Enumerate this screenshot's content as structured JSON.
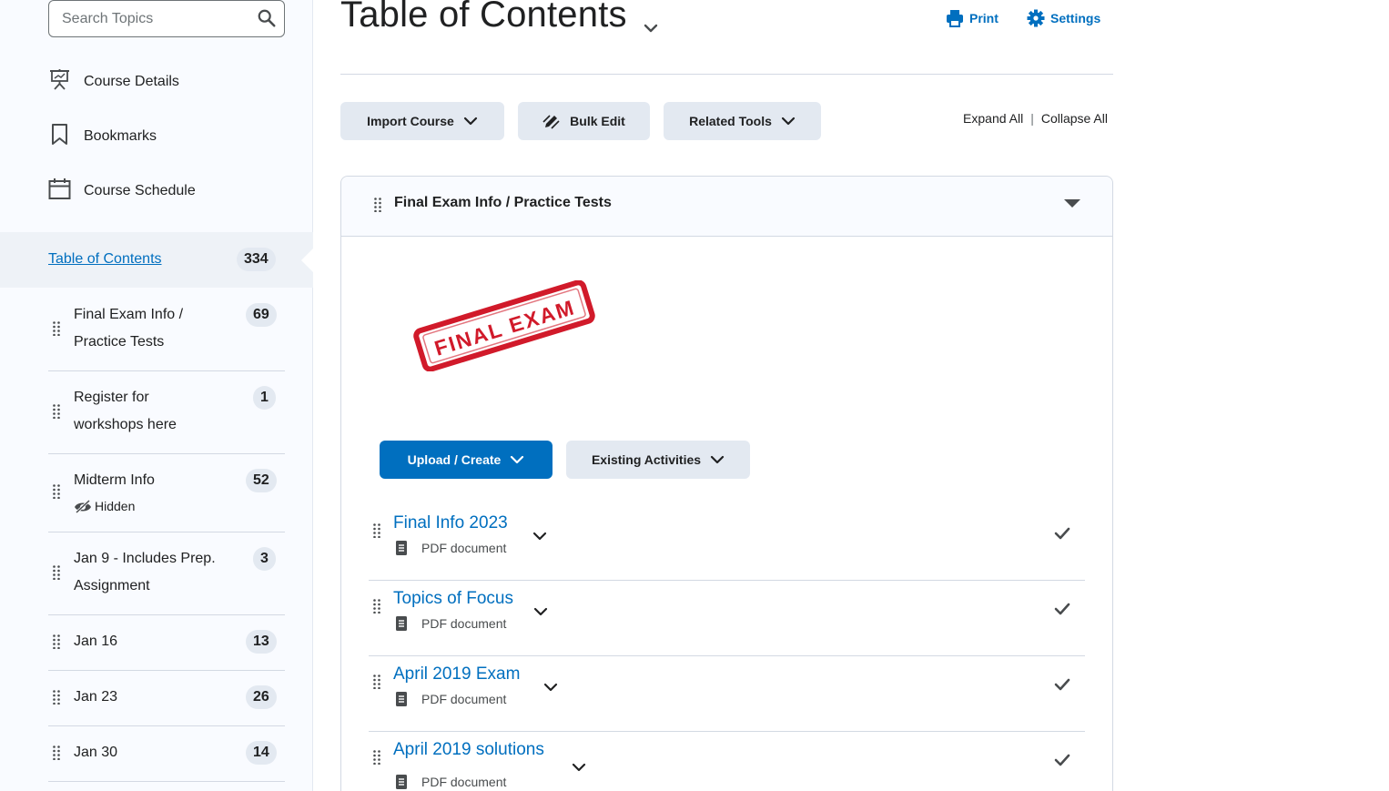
{
  "sidebar": {
    "search_placeholder": "Search Topics",
    "links": [
      {
        "label": "Course Details",
        "icon": "presentation-icon"
      },
      {
        "label": "Bookmarks",
        "icon": "bookmark-icon"
      },
      {
        "label": "Course Schedule",
        "icon": "calendar-icon"
      }
    ],
    "toc": {
      "label": "Table of Contents",
      "count": "334"
    },
    "modules": [
      {
        "title": "Final Exam Info / Practice Tests",
        "count": "69"
      },
      {
        "title": "Register for workshops here",
        "count": "1"
      },
      {
        "title": "Midterm Info",
        "count": "52",
        "status": "Hidden"
      },
      {
        "title": "Jan 9 - Includes Prep. Assignment",
        "count": "3"
      },
      {
        "title": "Jan 16",
        "count": "13"
      },
      {
        "title": "Jan 23",
        "count": "26"
      },
      {
        "title": "Jan 30",
        "count": "14"
      }
    ]
  },
  "header": {
    "title": "Table of Contents",
    "print_label": "Print",
    "settings_label": "Settings"
  },
  "toolbar": {
    "import_label": "Import Course",
    "bulk_edit_label": "Bulk Edit",
    "related_tools_label": "Related Tools",
    "expand_all": "Expand All",
    "collapse_all": "Collapse All"
  },
  "module": {
    "title": "Final Exam Info / Practice Tests",
    "stamp_text": "FINAL EXAM",
    "upload_label": "Upload / Create",
    "existing_label": "Existing Activities",
    "topics": [
      {
        "title": "Final Info 2023",
        "type": "PDF document"
      },
      {
        "title": "Topics of Focus",
        "type": "PDF document"
      },
      {
        "title": "April 2019 Exam",
        "type": "PDF document"
      },
      {
        "title": "April 2019 solutions",
        "type": "PDF document"
      }
    ]
  },
  "colors": {
    "accent": "#006fbf",
    "button_bg": "#e3e9f1",
    "sidebar_bg": "#f9fbff",
    "stamp_red": "#d11a2a"
  }
}
